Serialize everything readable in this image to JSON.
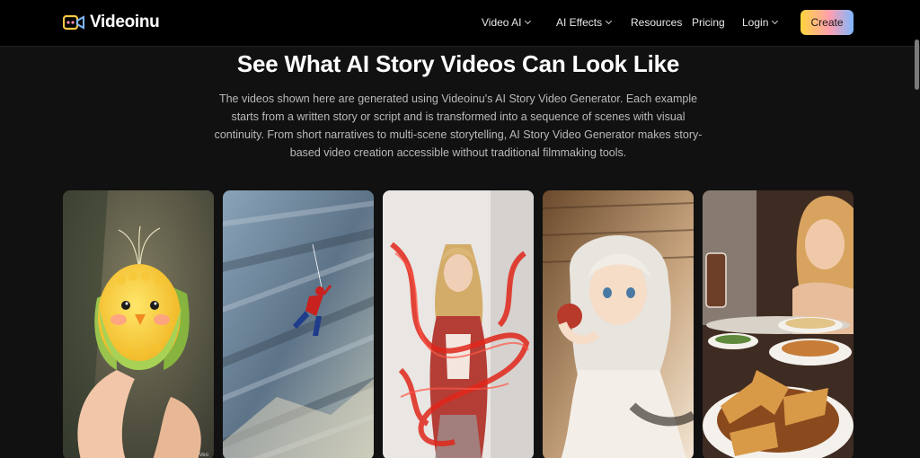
{
  "brand": {
    "name": "Videoinu"
  },
  "nav": {
    "items": [
      {
        "label": "Video AI",
        "dropdown": true
      },
      {
        "label": "AI Effects",
        "dropdown": true
      },
      {
        "label": "Resources",
        "dropdown": false
      },
      {
        "label": "Pricing",
        "dropdown": false
      },
      {
        "label": "Login",
        "dropdown": true
      }
    ],
    "cta": "Create"
  },
  "hero": {
    "title": "See What AI Story Videos Can Look Like",
    "description": "The videos shown here are generated using Videoinu's AI Story Video Generator. Each example starts from a written story or script and is transformed into a sequence of scenes with visual continuity. From short narratives to multi-scene storytelling, AI Story Video Generator makes story-based video creation accessible without traditional filmmaking tools."
  },
  "gallery": {
    "cards": [
      {
        "subject": "cute corn character held between fingers",
        "watermark": "Veo"
      },
      {
        "subject": "spider-man swinging between skyscrapers"
      },
      {
        "subject": "woman surrounded by red smoke"
      },
      {
        "subject": "anime girl eating an apple in sunlight"
      },
      {
        "subject": "woman eating at a table with fried food"
      }
    ]
  },
  "colors": {
    "background": "#111111",
    "navbar": "#000000",
    "cta_gradient": [
      "#ffd53d",
      "#ff9fb0",
      "#7fb7ff"
    ],
    "description_text": "#b9b9b9"
  }
}
